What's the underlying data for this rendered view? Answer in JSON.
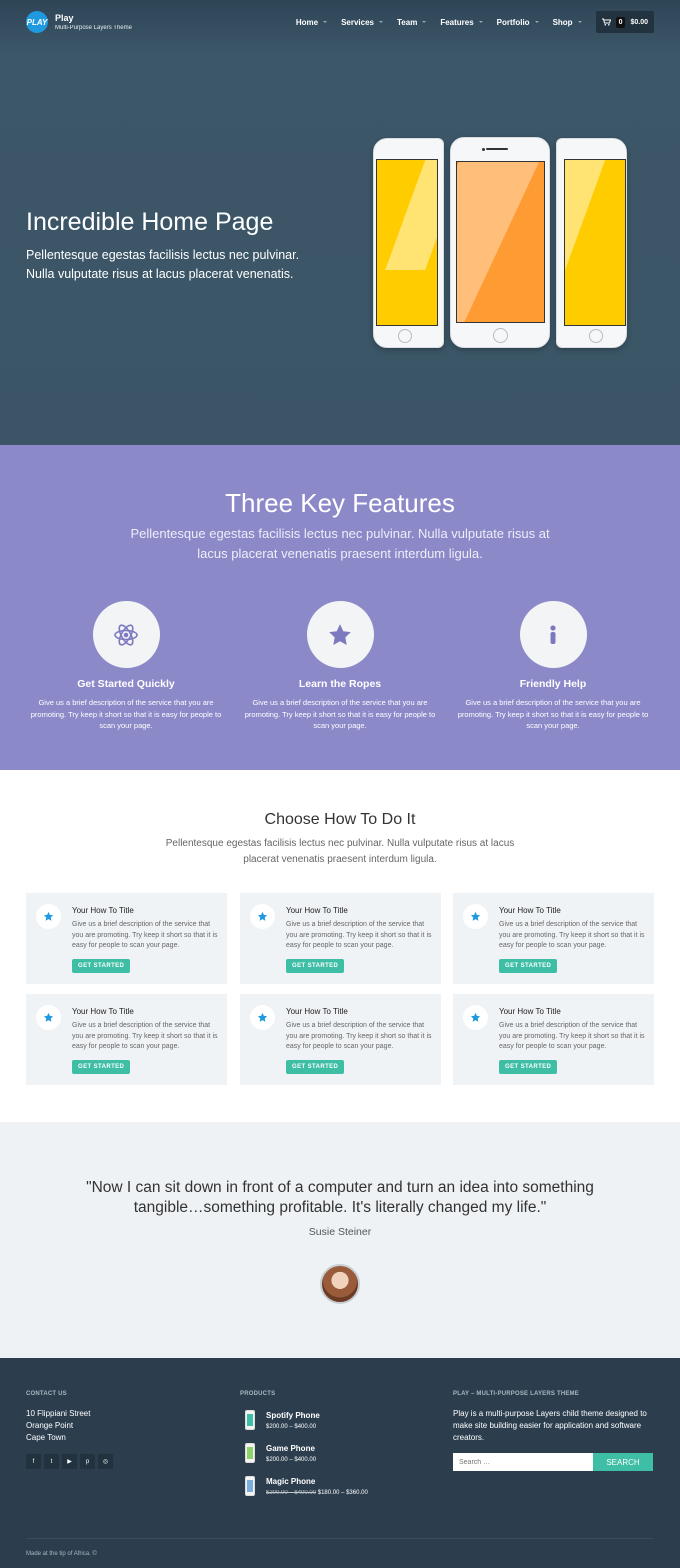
{
  "brand": {
    "name": "Play",
    "tagline": "Multi-Purpose Layers Theme",
    "logo_text": "PLAY"
  },
  "nav": {
    "items": [
      "Home",
      "Services",
      "Team",
      "Features",
      "Portfolio",
      "Shop"
    ],
    "cart_count": "0",
    "cart_total": "$0.00",
    "cart_icon": "cart-icon"
  },
  "hero": {
    "title": "Incredible Home Page",
    "subtitle": "Pellentesque egestas facilisis lectus nec pulvinar. Nulla vulputate risus at lacus placerat venenatis.",
    "colors": {
      "yellow": "#ffcc00",
      "orange": "#ff9b33"
    }
  },
  "features": {
    "title": "Three Key Features",
    "subtitle": "Pellentesque egestas facilisis lectus nec pulvinar. Nulla vulputate risus at lacus placerat venenatis praesent interdum ligula.",
    "items": [
      {
        "icon": "atom-icon",
        "title": "Get Started Quickly",
        "desc": "Give us a brief description of the service that you are promoting. Try keep it short so that it is easy for people to scan your page."
      },
      {
        "icon": "star-icon",
        "title": "Learn the Ropes",
        "desc": "Give us a brief description of the service that you are promoting. Try keep it short so that it is easy for people to scan your page."
      },
      {
        "icon": "info-icon",
        "title": "Friendly Help",
        "desc": "Give us a brief description of the service that you are promoting. Try keep it short so that it is easy for people to scan your page."
      }
    ]
  },
  "howto": {
    "title": "Choose How To Do It",
    "subtitle": "Pellentesque egestas facilisis lectus nec pulvinar. Nulla vulputate risus at lacus placerat venenatis praesent interdum ligula.",
    "cards": [
      {
        "title": "Your How To Title",
        "desc": "Give us a brief description of the service that you are promoting. Try keep it short so that it is easy for people to scan your page.",
        "button": "GET STARTED"
      },
      {
        "title": "Your How To Title",
        "desc": "Give us a brief description of the service that you are promoting. Try keep it short so that it is easy for people to scan your page.",
        "button": "GET STARTED"
      },
      {
        "title": "Your How To Title",
        "desc": "Give us a brief description of the service that you are promoting. Try keep it short so that it is easy for people to scan your page.",
        "button": "GET STARTED"
      },
      {
        "title": "Your How To Title",
        "desc": "Give us a brief description of the service that you are promoting. Try keep it short so that it is easy for people to scan your page.",
        "button": "GET STARTED"
      },
      {
        "title": "Your How To Title",
        "desc": "Give us a brief description of the service that you are promoting. Try keep it short so that it is easy for people to scan your page.",
        "button": "GET STARTED"
      },
      {
        "title": "Your How To Title",
        "desc": "Give us a brief description of the service that you are promoting. Try keep it short so that it is easy for people to scan your page.",
        "button": "GET STARTED"
      }
    ]
  },
  "testimonial": {
    "quote": "\"Now I can sit down in front of a computer and turn an idea into something tangible…something profitable. It's literally changed my life.\"",
    "author": "Susie Steiner"
  },
  "footer": {
    "contact": {
      "heading": "CONTACT US",
      "lines": [
        "10 Flippiani Street",
        "Orange Point",
        "Cape Town"
      ]
    },
    "social_icons": [
      "facebook-icon",
      "twitter-icon",
      "youtube-icon",
      "pinterest-icon",
      "dribbble-icon"
    ],
    "social_glyphs": [
      "f",
      "t",
      "▶",
      "p",
      "◎"
    ],
    "products": {
      "heading": "PRODUCTS",
      "items": [
        {
          "name": "Spotify Phone",
          "price": "$200.00 – $400.00",
          "old_price": "",
          "color": "#3ebea5"
        },
        {
          "name": "Game Phone",
          "price": "$200.00 – $400.00",
          "old_price": "",
          "color": "#8fd36b"
        },
        {
          "name": "Magic Phone",
          "price": "$180.00 – $360.00",
          "old_price": "$200.00 – $400.00",
          "color": "#7aaedc"
        }
      ]
    },
    "about": {
      "heading": "PLAY – MULTI-PURPOSE LAYERS THEME",
      "text": "Play is a multi-purpose Layers child theme designed to make site building easier for application and software creators."
    },
    "search": {
      "placeholder": "Search …",
      "button": "SEARCH"
    },
    "copyright": "Made at the tip of Africa. ©"
  }
}
